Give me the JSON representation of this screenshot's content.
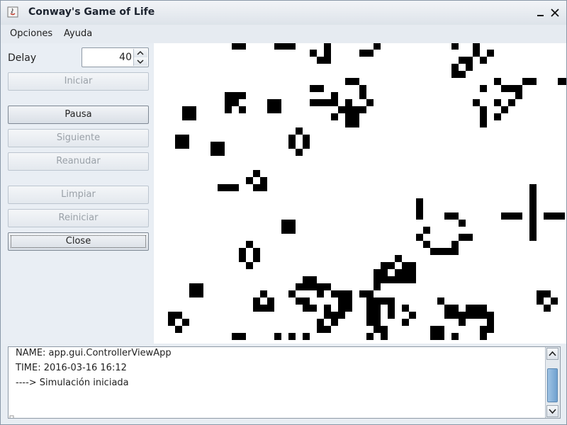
{
  "window": {
    "title": "Conway's Game of Life"
  },
  "menu": {
    "items": [
      {
        "label": "Opciones"
      },
      {
        "label": "Ayuda"
      }
    ]
  },
  "controls": {
    "delay_label": "Delay",
    "delay_value": "40",
    "buttons": {
      "iniciar": {
        "label": "Iniciar",
        "enabled": false
      },
      "pausa": {
        "label": "Pausa",
        "enabled": true
      },
      "siguiente": {
        "label": "Siguiente",
        "enabled": false
      },
      "reanudar": {
        "label": "Reanudar",
        "enabled": false
      },
      "limpiar": {
        "label": "Limpiar",
        "enabled": false
      },
      "reiniciar": {
        "label": "Reiniciar",
        "enabled": false
      },
      "close": {
        "label": "Close",
        "enabled": true
      }
    }
  },
  "log": {
    "lines": [
      "NAME: app.gui.ControllerViewApp",
      "TIME: 2016-03-16 16:12",
      "----> Simulación iniciada"
    ]
  },
  "colors": {
    "live_cell": "#000000",
    "dead_cell": "#ffffff",
    "scroll_thumb": "#7faad4"
  }
}
